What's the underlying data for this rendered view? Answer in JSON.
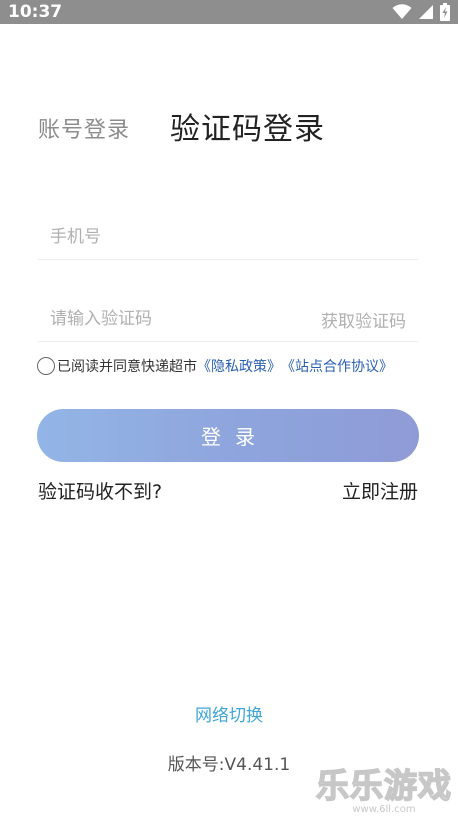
{
  "status_bar": {
    "time": "10:37",
    "icons": [
      "wifi-icon",
      "signal-icon",
      "battery-charging-icon"
    ]
  },
  "login": {
    "tab_account": "账号登录",
    "tab_sms": "验证码登录",
    "phone_placeholder": "手机号",
    "code_placeholder": "请输入验证码",
    "get_code": "获取验证码",
    "agree_prefix": "已阅读并同意快递超市",
    "privacy_link": "《隐私政策》",
    "partner_link": "《站点合作协议》",
    "login_button": "登录",
    "no_code": "验证码收不到?",
    "register": "立即注册"
  },
  "footer": {
    "network_switch": "网络切换",
    "version_label": "版本号:",
    "version_value": "V4.41.1"
  },
  "watermark": {
    "text": "乐乐游戏",
    "url": "www.6ll.com"
  },
  "colors": {
    "status_bar": "#8e8e8e",
    "button_gradient_start": "#93b5e6",
    "button_gradient_end": "#8f9bd6",
    "link": "#2a5fb0",
    "network_switch": "#3fa6d6"
  }
}
